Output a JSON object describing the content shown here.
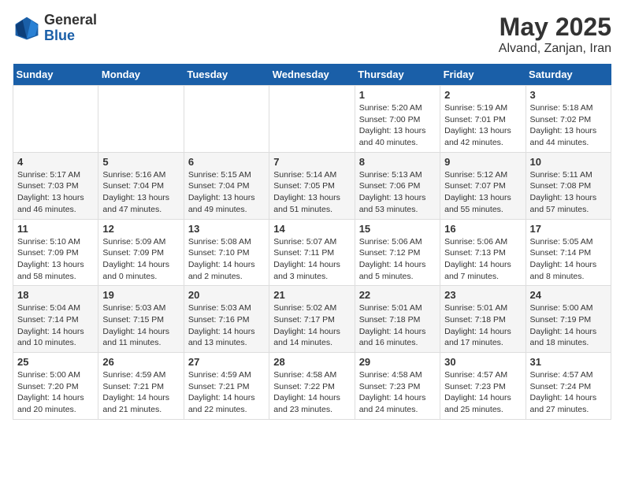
{
  "header": {
    "logo_general": "General",
    "logo_blue": "Blue",
    "month_year": "May 2025",
    "location": "Alvand, Zanjan, Iran"
  },
  "weekdays": [
    "Sunday",
    "Monday",
    "Tuesday",
    "Wednesday",
    "Thursday",
    "Friday",
    "Saturday"
  ],
  "weeks": [
    [
      {
        "day": "",
        "info": ""
      },
      {
        "day": "",
        "info": ""
      },
      {
        "day": "",
        "info": ""
      },
      {
        "day": "",
        "info": ""
      },
      {
        "day": "1",
        "info": "Sunrise: 5:20 AM\nSunset: 7:00 PM\nDaylight: 13 hours\nand 40 minutes."
      },
      {
        "day": "2",
        "info": "Sunrise: 5:19 AM\nSunset: 7:01 PM\nDaylight: 13 hours\nand 42 minutes."
      },
      {
        "day": "3",
        "info": "Sunrise: 5:18 AM\nSunset: 7:02 PM\nDaylight: 13 hours\nand 44 minutes."
      }
    ],
    [
      {
        "day": "4",
        "info": "Sunrise: 5:17 AM\nSunset: 7:03 PM\nDaylight: 13 hours\nand 46 minutes."
      },
      {
        "day": "5",
        "info": "Sunrise: 5:16 AM\nSunset: 7:04 PM\nDaylight: 13 hours\nand 47 minutes."
      },
      {
        "day": "6",
        "info": "Sunrise: 5:15 AM\nSunset: 7:04 PM\nDaylight: 13 hours\nand 49 minutes."
      },
      {
        "day": "7",
        "info": "Sunrise: 5:14 AM\nSunset: 7:05 PM\nDaylight: 13 hours\nand 51 minutes."
      },
      {
        "day": "8",
        "info": "Sunrise: 5:13 AM\nSunset: 7:06 PM\nDaylight: 13 hours\nand 53 minutes."
      },
      {
        "day": "9",
        "info": "Sunrise: 5:12 AM\nSunset: 7:07 PM\nDaylight: 13 hours\nand 55 minutes."
      },
      {
        "day": "10",
        "info": "Sunrise: 5:11 AM\nSunset: 7:08 PM\nDaylight: 13 hours\nand 57 minutes."
      }
    ],
    [
      {
        "day": "11",
        "info": "Sunrise: 5:10 AM\nSunset: 7:09 PM\nDaylight: 13 hours\nand 58 minutes."
      },
      {
        "day": "12",
        "info": "Sunrise: 5:09 AM\nSunset: 7:09 PM\nDaylight: 14 hours\nand 0 minutes."
      },
      {
        "day": "13",
        "info": "Sunrise: 5:08 AM\nSunset: 7:10 PM\nDaylight: 14 hours\nand 2 minutes."
      },
      {
        "day": "14",
        "info": "Sunrise: 5:07 AM\nSunset: 7:11 PM\nDaylight: 14 hours\nand 3 minutes."
      },
      {
        "day": "15",
        "info": "Sunrise: 5:06 AM\nSunset: 7:12 PM\nDaylight: 14 hours\nand 5 minutes."
      },
      {
        "day": "16",
        "info": "Sunrise: 5:06 AM\nSunset: 7:13 PM\nDaylight: 14 hours\nand 7 minutes."
      },
      {
        "day": "17",
        "info": "Sunrise: 5:05 AM\nSunset: 7:14 PM\nDaylight: 14 hours\nand 8 minutes."
      }
    ],
    [
      {
        "day": "18",
        "info": "Sunrise: 5:04 AM\nSunset: 7:14 PM\nDaylight: 14 hours\nand 10 minutes."
      },
      {
        "day": "19",
        "info": "Sunrise: 5:03 AM\nSunset: 7:15 PM\nDaylight: 14 hours\nand 11 minutes."
      },
      {
        "day": "20",
        "info": "Sunrise: 5:03 AM\nSunset: 7:16 PM\nDaylight: 14 hours\nand 13 minutes."
      },
      {
        "day": "21",
        "info": "Sunrise: 5:02 AM\nSunset: 7:17 PM\nDaylight: 14 hours\nand 14 minutes."
      },
      {
        "day": "22",
        "info": "Sunrise: 5:01 AM\nSunset: 7:18 PM\nDaylight: 14 hours\nand 16 minutes."
      },
      {
        "day": "23",
        "info": "Sunrise: 5:01 AM\nSunset: 7:18 PM\nDaylight: 14 hours\nand 17 minutes."
      },
      {
        "day": "24",
        "info": "Sunrise: 5:00 AM\nSunset: 7:19 PM\nDaylight: 14 hours\nand 18 minutes."
      }
    ],
    [
      {
        "day": "25",
        "info": "Sunrise: 5:00 AM\nSunset: 7:20 PM\nDaylight: 14 hours\nand 20 minutes."
      },
      {
        "day": "26",
        "info": "Sunrise: 4:59 AM\nSunset: 7:21 PM\nDaylight: 14 hours\nand 21 minutes."
      },
      {
        "day": "27",
        "info": "Sunrise: 4:59 AM\nSunset: 7:21 PM\nDaylight: 14 hours\nand 22 minutes."
      },
      {
        "day": "28",
        "info": "Sunrise: 4:58 AM\nSunset: 7:22 PM\nDaylight: 14 hours\nand 23 minutes."
      },
      {
        "day": "29",
        "info": "Sunrise: 4:58 AM\nSunset: 7:23 PM\nDaylight: 14 hours\nand 24 minutes."
      },
      {
        "day": "30",
        "info": "Sunrise: 4:57 AM\nSunset: 7:23 PM\nDaylight: 14 hours\nand 25 minutes."
      },
      {
        "day": "31",
        "info": "Sunrise: 4:57 AM\nSunset: 7:24 PM\nDaylight: 14 hours\nand 27 minutes."
      }
    ]
  ]
}
